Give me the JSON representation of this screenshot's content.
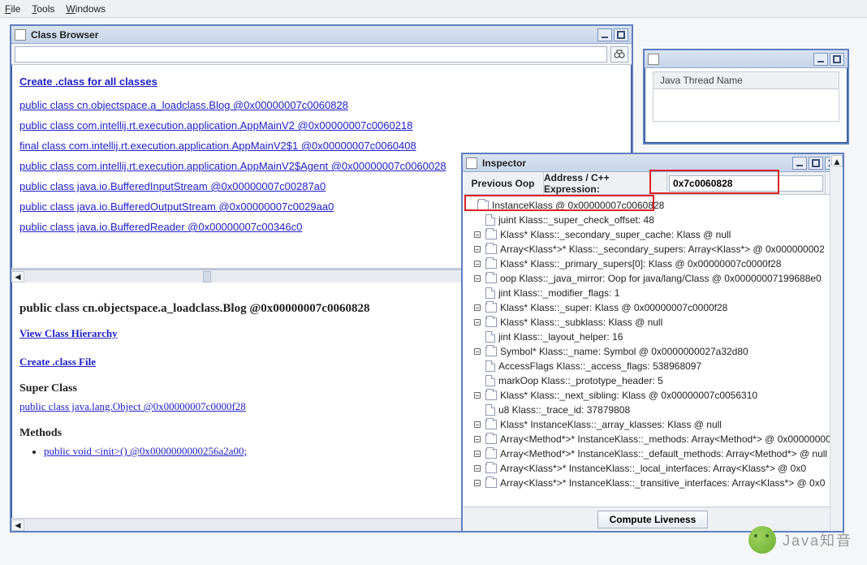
{
  "menubar": {
    "file": "File",
    "tools": "Tools",
    "windows": "Windows"
  },
  "classBrowser": {
    "title": "Class Browser",
    "search_value": "",
    "create_all": "Create .class for all classes",
    "classes": [
      "public class cn.objectspace.a_loadclass.Blog @0x00000007c0060828",
      "public class com.intellij.rt.execution.application.AppMainV2 @0x00000007c0060218",
      "final class com.intellij.rt.execution.application.AppMainV2$1 @0x00000007c0060408",
      "public class com.intellij.rt.execution.application.AppMainV2$Agent @0x00000007c0060028",
      "public class java.io.BufferedInputStream @0x00000007c00287a0",
      "public class java.io.BufferedOutputStream @0x00000007c0029aa0",
      "public class java.io.BufferedReader @0x00000007c00346c0"
    ],
    "detail": {
      "heading": "public class cn.objectspace.a_loadclass.Blog @0x00000007c0060828",
      "view_hierarchy": "View Class Hierarchy",
      "create_file": "Create .class File",
      "super_label": "Super Class",
      "super_link": "public class java.lang.Object @0x00000007c0000f28",
      "methods_label": "Methods",
      "method0": "public void <init>() @0x0000000000256a2a00;"
    }
  },
  "threads": {
    "title": "",
    "col0": "Java Thread Name"
  },
  "inspector": {
    "title": "Inspector",
    "prev_label": "Previous Oop",
    "addr_label": "Address / C++ Expression:",
    "addr_value": "0x7c0060828",
    "compute": "Compute Liveness",
    "nodes": [
      {
        "d": 0,
        "h": "",
        "i": "folder",
        "t": "InstanceKlass @ 0x00000007c0060828"
      },
      {
        "d": 1,
        "h": "",
        "i": "doc",
        "t": "juint Klass::_super_check_offset: 48"
      },
      {
        "d": 1,
        "h": "o",
        "i": "folder",
        "t": "Klass* Klass::_secondary_super_cache: Klass @ null"
      },
      {
        "d": 1,
        "h": "o",
        "i": "folder",
        "t": "Array<Klass*>* Klass::_secondary_supers: Array<Klass*> @ 0x000000002"
      },
      {
        "d": 1,
        "h": "o",
        "i": "folder",
        "t": "Klass* Klass::_primary_supers[0]: Klass @ 0x00000007c0000f28"
      },
      {
        "d": 1,
        "h": "o",
        "i": "folder",
        "t": "oop Klass::_java_mirror: Oop for java/lang/Class @ 0x00000007199688e0"
      },
      {
        "d": 1,
        "h": "",
        "i": "doc",
        "t": "jint Klass::_modifier_flags: 1"
      },
      {
        "d": 1,
        "h": "o",
        "i": "folder",
        "t": "Klass* Klass::_super: Klass @ 0x00000007c0000f28"
      },
      {
        "d": 1,
        "h": "o",
        "i": "folder",
        "t": "Klass* Klass::_subklass: Klass @ null"
      },
      {
        "d": 1,
        "h": "",
        "i": "doc",
        "t": "jint Klass::_layout_helper: 16"
      },
      {
        "d": 1,
        "h": "o",
        "i": "folder",
        "t": "Symbol* Klass::_name: Symbol @ 0x0000000027a32d80"
      },
      {
        "d": 1,
        "h": "",
        "i": "doc",
        "t": "AccessFlags Klass::_access_flags: 538968097"
      },
      {
        "d": 1,
        "h": "",
        "i": "doc",
        "t": "markOop Klass::_prototype_header: 5"
      },
      {
        "d": 1,
        "h": "o",
        "i": "folder",
        "t": "Klass* Klass::_next_sibling: Klass @ 0x00000007c0056310"
      },
      {
        "d": 1,
        "h": "",
        "i": "doc",
        "t": "u8 Klass::_trace_id: 37879808"
      },
      {
        "d": 1,
        "h": "o",
        "i": "folder",
        "t": "Klass* InstanceKlass::_array_klasses: Klass @ null"
      },
      {
        "d": 1,
        "h": "o",
        "i": "folder",
        "t": "Array<Method*>* InstanceKlass::_methods: Array<Method*> @ 0x00000000"
      },
      {
        "d": 1,
        "h": "o",
        "i": "folder",
        "t": "Array<Method*>* InstanceKlass::_default_methods: Array<Method*> @ null"
      },
      {
        "d": 1,
        "h": "o",
        "i": "folder",
        "t": "Array<Klass*>* InstanceKlass::_local_interfaces: Array<Klass*> @ 0x0"
      },
      {
        "d": 1,
        "h": "o",
        "i": "folder",
        "t": "Array<Klass*>* InstanceKlass::_transitive_interfaces: Array<Klass*> @ 0x0"
      }
    ]
  },
  "watermark": "Java知音"
}
